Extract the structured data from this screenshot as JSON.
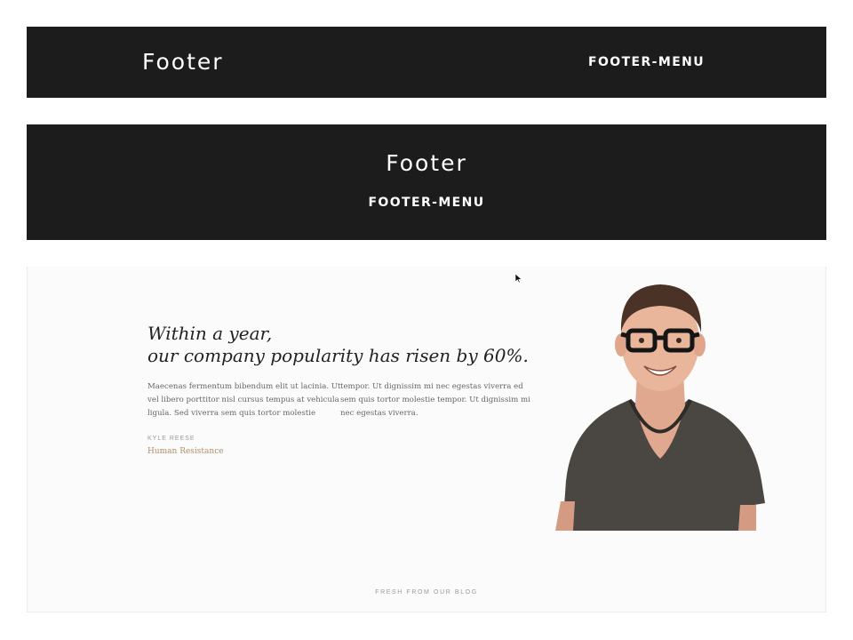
{
  "footer_variant_a": {
    "logo": "Footer",
    "menu": "FOOTER-MENU"
  },
  "footer_variant_b": {
    "logo": "Footer",
    "menu": "FOOTER-MENU"
  },
  "testimonial": {
    "quote_line_1": "Within a year,",
    "quote_line_2": "our company popularity has risen by 60%.",
    "body_left": [
      "Maecenas fermentum bibendum elit ut lacinia. Ut",
      "vel libero porttitor nisl cursus tempus at vehicula",
      "ligula. Sed viverra sem quis tortor molestie"
    ],
    "body_right": [
      "tempor. Ut dignissim mi nec egestas viverra ed",
      "sem quis tortor molestie tempor. Ut dignissim mi",
      "nec egestas viverra."
    ],
    "author_name": "KYLE REESE",
    "author_company": "Human Resistance",
    "portrait_icon": "man-with-glasses-photo"
  },
  "blog_section": {
    "label": "FRESH FROM OUR BLOG"
  },
  "colors": {
    "footer_bg": "#1c1c1c",
    "footer_text": "#ffffff",
    "accent": "#b08f6a",
    "section_bg": "#fbfbfb"
  },
  "icons": {
    "cursor": "mouse-pointer-icon"
  }
}
